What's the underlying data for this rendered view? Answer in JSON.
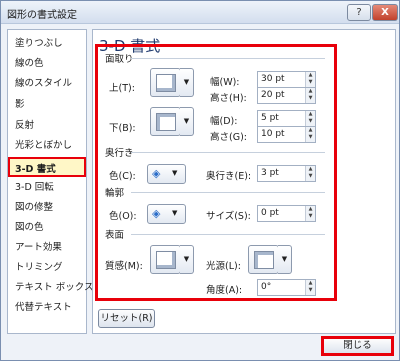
{
  "window": {
    "title": "図形の書式設定",
    "help_label": "?",
    "close_label": "X"
  },
  "nav": {
    "items": [
      "塗りつぶし",
      "線の色",
      "線のスタイル",
      "影",
      "反射",
      "光彩とぼかし",
      "3-D 書式",
      "3-D 回転",
      "図の修整",
      "図の色",
      "アート効果",
      "トリミング",
      "テキスト ボックス",
      "代替テキスト"
    ],
    "selected_index": 6
  },
  "panel": {
    "title": "3-D 書式",
    "bevel": {
      "section": "面取り",
      "top_label": "上(T):",
      "bottom_label": "下(B):",
      "top_width_label": "幅(W):",
      "top_width_value": "30 pt",
      "top_height_label": "高さ(H):",
      "top_height_value": "20 pt",
      "bottom_width_label": "幅(D):",
      "bottom_width_value": "5 pt",
      "bottom_height_label": "高さ(G):",
      "bottom_height_value": "10 pt"
    },
    "depth": {
      "section": "奥行き",
      "color_label": "色(C):",
      "depth_label": "奥行き(E):",
      "depth_value": "3 pt"
    },
    "contour": {
      "section": "輪郭",
      "color_label": "色(O):",
      "size_label": "サイズ(S):",
      "size_value": "0 pt"
    },
    "surface": {
      "section": "表面",
      "material_label": "質感(M):",
      "lighting_label": "光源(L):",
      "angle_label": "角度(A):",
      "angle_value": "0°"
    },
    "reset_label": "リセット(R)"
  },
  "footer": {
    "close_label": "閉じる"
  }
}
